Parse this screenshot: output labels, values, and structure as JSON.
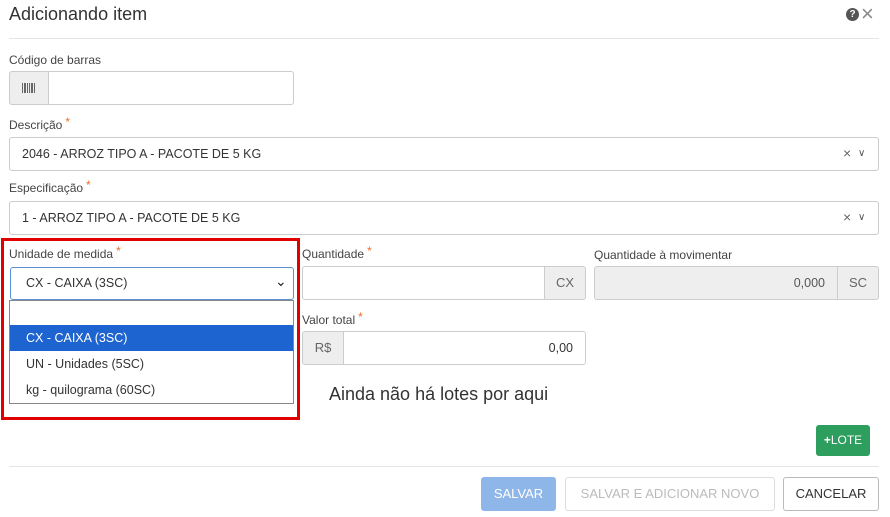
{
  "modal": {
    "title": "Adicionando item",
    "help_icon": "?",
    "close_icon": "×"
  },
  "barcode": {
    "label": "Código de barras",
    "value": ""
  },
  "descricao": {
    "label": "Descrição",
    "required": "*",
    "value": "2046 - ARROZ TIPO A - PACOTE DE 5 KG"
  },
  "especificacao": {
    "label": "Especificação",
    "required": "*",
    "value": "1 - ARROZ TIPO A - PACOTE DE 5 KG"
  },
  "unidade": {
    "label": "Unidade de medida",
    "required": "*",
    "value": "CX - CAIXA (3SC)",
    "options": [
      "",
      "CX - CAIXA (3SC)",
      "UN - Unidades (5SC)",
      "kg - quilograma (60SC)"
    ]
  },
  "quantidade": {
    "label": "Quantidade",
    "required": "*",
    "value": "",
    "unit": "CX"
  },
  "quantidade_movimentar": {
    "label": "Quantidade à movimentar",
    "value": "0,000",
    "unit": "SC"
  },
  "valor_total": {
    "label": "Valor total",
    "required": "*",
    "currency": "R$",
    "value": "0,00"
  },
  "lotes": {
    "empty_message": "Ainda não há lotes por aqui",
    "add_button": "LOTE",
    "add_icon": "+"
  },
  "footer": {
    "save": "SALVAR",
    "save_add_new": "SALVAR E ADICIONAR NOVO",
    "cancel": "CANCELAR"
  },
  "colors": {
    "selected_option": "#1e64d0",
    "highlight_box": "#e00000",
    "required": "#e8702a",
    "add_lote": "#2e9e5e",
    "save_disabled": "#8fb6e8"
  }
}
